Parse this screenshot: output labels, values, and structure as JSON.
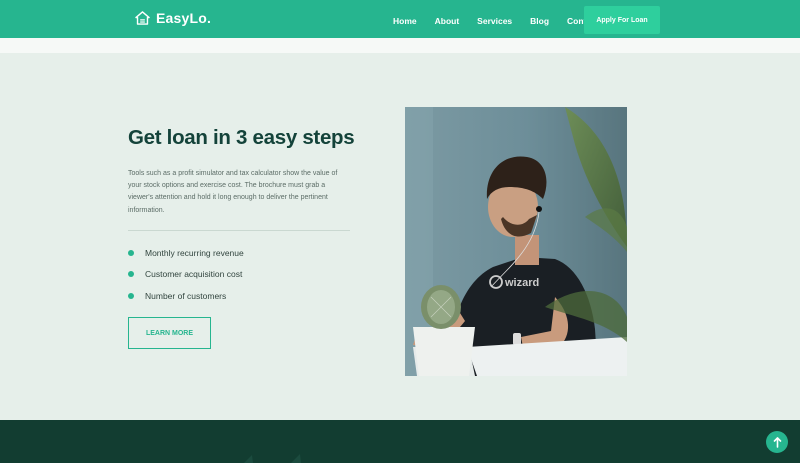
{
  "brand": {
    "name": "EasyLo.",
    "logo_icon": "house-icon"
  },
  "nav": {
    "links": [
      "Home",
      "About",
      "Services",
      "Blog",
      "Contact"
    ],
    "cta_label": "Apply For Loan"
  },
  "section": {
    "title": "Get loan in 3 easy steps",
    "description": "Tools such as a profit simulator and tax calculator show the value of your stock options and exercise cost. The brochure must grab a viewer's attention and hold it long enough to deliver the pertinent information.",
    "features": [
      "Monthly recurring revenue",
      "Customer acquisition cost",
      "Number of customers"
    ],
    "button_label": "LEARN MORE"
  },
  "image": {
    "shirt_text": "wizard"
  },
  "scroll_top": {
    "icon": "arrow-up-icon"
  },
  "colors": {
    "accent": "#26b58f",
    "accent_light": "#2ecf9d",
    "background": "#e6efea",
    "heading": "#14433a",
    "footer": "#123d31"
  }
}
